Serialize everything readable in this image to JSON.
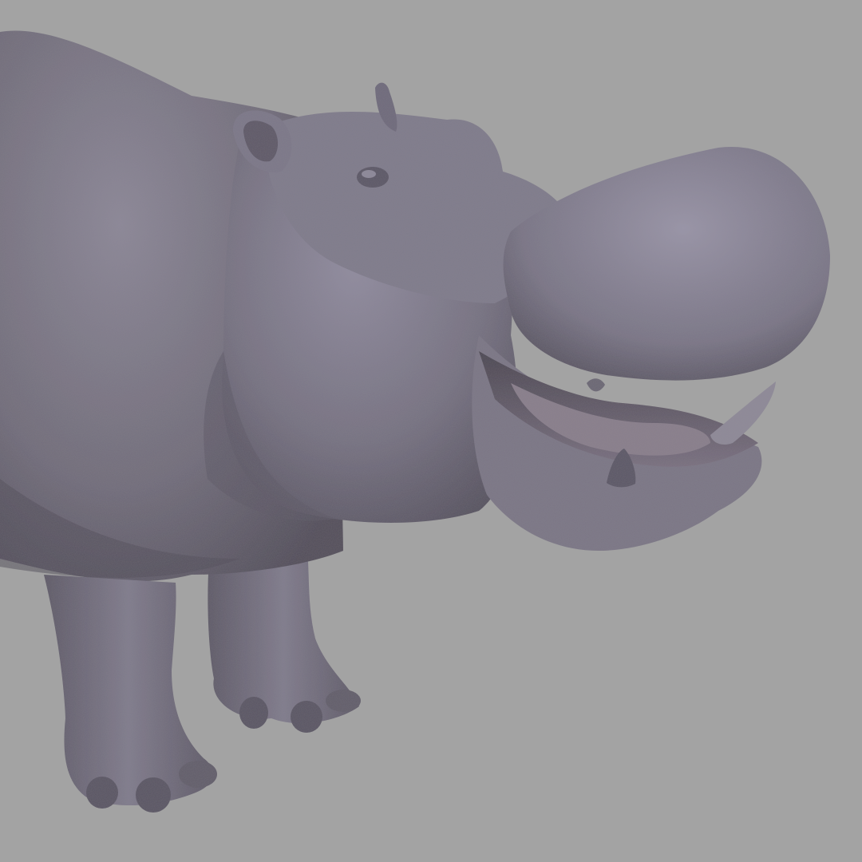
{
  "scene": {
    "subject": "hippopotamus-sculpt",
    "colors": {
      "background": "#a3a3a3",
      "skin_base": "#76717f",
      "skin_highlight": "#9a95a6",
      "skin_shadow": "#4e4956",
      "mouth_inner": "#6f6472",
      "tooth": "#8c8694"
    }
  }
}
